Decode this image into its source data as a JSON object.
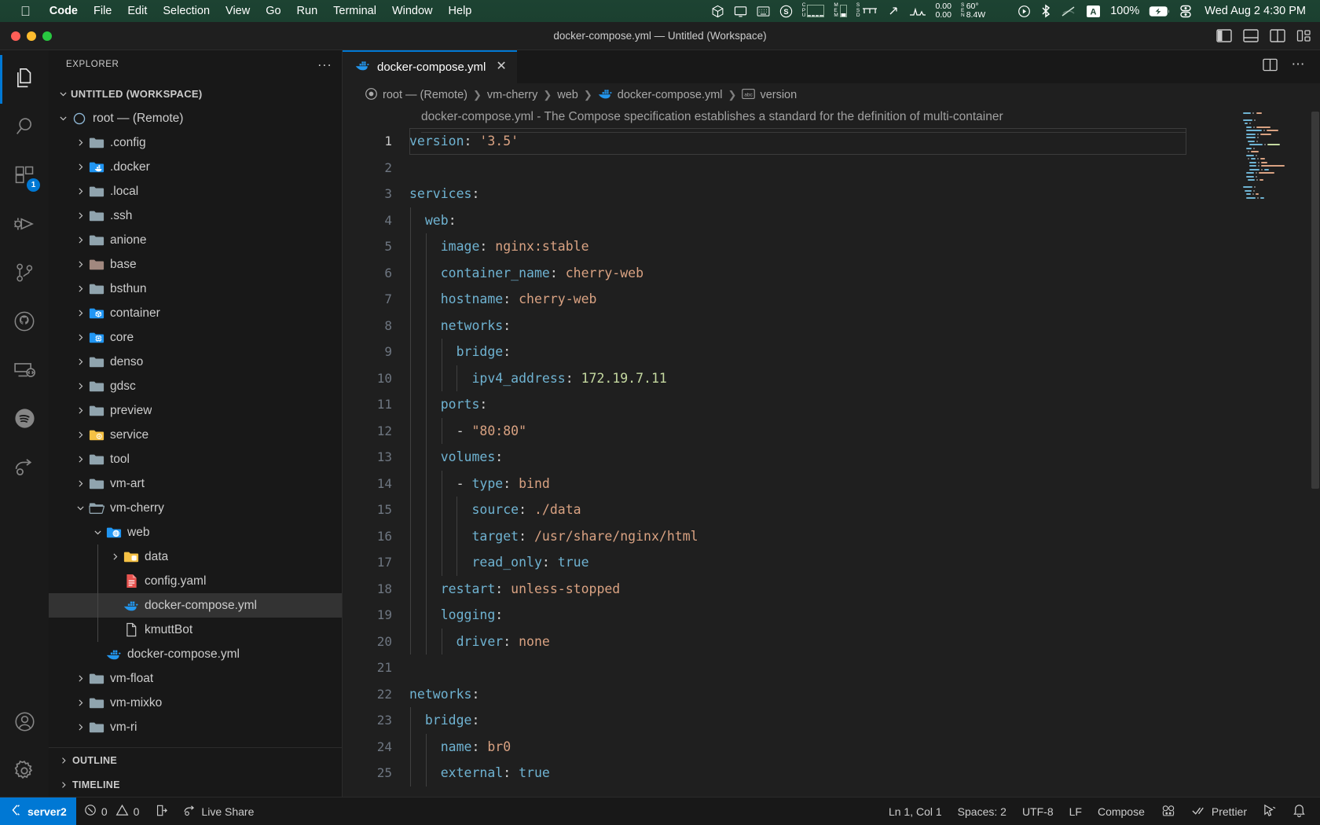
{
  "macos_menu": {
    "apple_icon": "apple-logo-icon",
    "items": [
      {
        "label": "Code",
        "bold": true
      },
      {
        "label": "File",
        "bold": false
      },
      {
        "label": "Edit",
        "bold": false
      },
      {
        "label": "Selection",
        "bold": false
      },
      {
        "label": "View",
        "bold": false
      },
      {
        "label": "Go",
        "bold": false
      },
      {
        "label": "Run",
        "bold": false
      },
      {
        "label": "Terminal",
        "bold": false
      },
      {
        "label": "Window",
        "bold": false
      },
      {
        "label": "Help",
        "bold": false
      }
    ],
    "tray": {
      "cpu_label_top": "C",
      "cpu_label_mid": "P",
      "cpu_label_bot": "U",
      "mem_label": "MEM",
      "ssd_label": "SSD",
      "net_down": "0.00",
      "net_up": "0.00",
      "sen_label": "SEN",
      "temp": "60°",
      "power": "8.4W",
      "battery_pct": "100%",
      "clock": "Wed Aug 2  4:30 PM",
      "input_source": "A",
      "icons": [
        "stats-s-icon",
        "cpu-graph-icon",
        "mem-bar-icon",
        "ssd-bar-icon",
        "network-speed-icon",
        "temperature-icon",
        "airpods-icon",
        "now-playing-icon",
        "bluetooth-icon",
        "wifi-off-icon",
        "input-source-icon",
        "battery-charging-icon",
        "control-center-icon"
      ]
    }
  },
  "window": {
    "title": "docker-compose.yml — Untitled (Workspace)",
    "traffic_lights": [
      "close-button",
      "minimize-button",
      "maximize-button"
    ],
    "layout_buttons": [
      "toggle-primary-sidebar-icon",
      "toggle-panel-icon",
      "toggle-secondary-sidebar-icon",
      "customize-layout-icon"
    ]
  },
  "activity_bar": {
    "items": [
      {
        "name": "explorer",
        "icon": "files-icon",
        "active": true,
        "badge": null
      },
      {
        "name": "search",
        "icon": "search-icon",
        "active": false,
        "badge": null
      },
      {
        "name": "extensions",
        "icon": "extensions-icon",
        "active": false,
        "badge": "1"
      },
      {
        "name": "run-and-debug",
        "icon": "run-debug-icon",
        "active": false,
        "badge": null
      },
      {
        "name": "source-control",
        "icon": "source-control-icon",
        "active": false,
        "badge": null
      },
      {
        "name": "github",
        "icon": "github-icon",
        "active": false,
        "badge": null
      },
      {
        "name": "remote-explorer",
        "icon": "remote-explorer-icon",
        "active": false,
        "badge": null
      },
      {
        "name": "spotify",
        "icon": "spotify-icon",
        "active": false,
        "badge": null
      },
      {
        "name": "live-share",
        "icon": "live-share-icon",
        "active": false,
        "badge": null
      }
    ],
    "bottom_items": [
      {
        "name": "accounts",
        "icon": "account-icon"
      },
      {
        "name": "manage-settings",
        "icon": "gear-icon"
      }
    ]
  },
  "sidebar": {
    "title": "EXPLORER",
    "more_actions": "...",
    "workspace_label": "UNTITLED (WORKSPACE)",
    "tree": [
      {
        "label": "root — (Remote)",
        "depth": 1,
        "twisty": "down",
        "icon": "remote-circle-icon",
        "selected": false
      },
      {
        "label": ".config",
        "depth": 2,
        "twisty": "right",
        "icon": "folder-icon",
        "selected": false
      },
      {
        "label": ".docker",
        "depth": 2,
        "twisty": "right",
        "icon": "folder-docker-icon",
        "selected": false
      },
      {
        "label": ".local",
        "depth": 2,
        "twisty": "right",
        "icon": "folder-icon",
        "selected": false
      },
      {
        "label": ".ssh",
        "depth": 2,
        "twisty": "right",
        "icon": "folder-icon",
        "selected": false
      },
      {
        "label": "anione",
        "depth": 2,
        "twisty": "right",
        "icon": "folder-icon",
        "selected": false
      },
      {
        "label": "base",
        "depth": 2,
        "twisty": "right",
        "icon": "folder-base-icon",
        "selected": false
      },
      {
        "label": "bsthun",
        "depth": 2,
        "twisty": "right",
        "icon": "folder-icon",
        "selected": false
      },
      {
        "label": "container",
        "depth": 2,
        "twisty": "right",
        "icon": "folder-container-icon",
        "selected": false
      },
      {
        "label": "core",
        "depth": 2,
        "twisty": "right",
        "icon": "folder-core-icon",
        "selected": false
      },
      {
        "label": "denso",
        "depth": 2,
        "twisty": "right",
        "icon": "folder-icon",
        "selected": false
      },
      {
        "label": "gdsc",
        "depth": 2,
        "twisty": "right",
        "icon": "folder-icon",
        "selected": false
      },
      {
        "label": "preview",
        "depth": 2,
        "twisty": "right",
        "icon": "folder-icon",
        "selected": false
      },
      {
        "label": "service",
        "depth": 2,
        "twisty": "right",
        "icon": "folder-service-icon",
        "selected": false
      },
      {
        "label": "tool",
        "depth": 2,
        "twisty": "right",
        "icon": "folder-icon",
        "selected": false
      },
      {
        "label": "vm-art",
        "depth": 2,
        "twisty": "right",
        "icon": "folder-icon",
        "selected": false
      },
      {
        "label": "vm-cherry",
        "depth": 2,
        "twisty": "down",
        "icon": "folder-open-icon",
        "selected": false
      },
      {
        "label": "web",
        "depth": 3,
        "twisty": "down",
        "icon": "folder-web-icon",
        "selected": false
      },
      {
        "label": "data",
        "depth": 4,
        "twisty": "right",
        "icon": "folder-data-icon",
        "selected": false
      },
      {
        "label": "config.yaml",
        "depth": 4,
        "twisty": "none",
        "icon": "yaml-file-icon",
        "selected": false
      },
      {
        "label": "docker-compose.yml",
        "depth": 4,
        "twisty": "none",
        "icon": "docker-file-icon",
        "selected": true
      },
      {
        "label": "kmuttBot",
        "depth": 4,
        "twisty": "none",
        "icon": "plain-file-icon",
        "selected": false
      },
      {
        "label": "docker-compose.yml",
        "depth": 3,
        "twisty": "none",
        "icon": "docker-file-icon",
        "selected": false
      },
      {
        "label": "vm-float",
        "depth": 2,
        "twisty": "right",
        "icon": "folder-icon",
        "selected": false
      },
      {
        "label": "vm-mixko",
        "depth": 2,
        "twisty": "right",
        "icon": "folder-icon",
        "selected": false
      },
      {
        "label": "vm-ri",
        "depth": 2,
        "twisty": "right",
        "icon": "folder-icon",
        "selected": false
      }
    ],
    "sections": [
      {
        "label": "OUTLINE"
      },
      {
        "label": "TIMELINE"
      }
    ]
  },
  "editor": {
    "tab": {
      "label": "docker-compose.yml",
      "icon": "docker-file-icon",
      "close": "✕"
    },
    "actions": [
      "split-editor-icon",
      "more-actions-icon"
    ],
    "breadcrumbs": [
      {
        "label": "root — (Remote)",
        "icon": "remote-circle-icon"
      },
      {
        "label": "vm-cherry",
        "icon": null
      },
      {
        "label": "web",
        "icon": null
      },
      {
        "label": "docker-compose.yml",
        "icon": "docker-file-icon"
      },
      {
        "label": "version",
        "icon": "symbol-string-icon"
      }
    ],
    "hover_text": "docker-compose.yml - The Compose specification establishes a standard for the definition of multi-container",
    "lines": [
      {
        "n": 1,
        "current": true,
        "indent_guides": 0,
        "tokens": [
          {
            "t": "version",
            "c": "k"
          },
          {
            "t": ":",
            "c": "p"
          },
          {
            "t": " ",
            "c": "p"
          },
          {
            "t": "'3.5'",
            "c": "s"
          }
        ]
      },
      {
        "n": 2,
        "current": false,
        "indent_guides": 0,
        "tokens": []
      },
      {
        "n": 3,
        "current": false,
        "indent_guides": 0,
        "tokens": [
          {
            "t": "services",
            "c": "k"
          },
          {
            "t": ":",
            "c": "p"
          }
        ]
      },
      {
        "n": 4,
        "current": false,
        "indent_guides": 1,
        "tokens": [
          {
            "t": "  ",
            "c": "p"
          },
          {
            "t": "web",
            "c": "k"
          },
          {
            "t": ":",
            "c": "p"
          }
        ]
      },
      {
        "n": 5,
        "current": false,
        "indent_guides": 2,
        "tokens": [
          {
            "t": "    ",
            "c": "p"
          },
          {
            "t": "image",
            "c": "k"
          },
          {
            "t": ": ",
            "c": "p"
          },
          {
            "t": "nginx:stable",
            "c": "s"
          }
        ]
      },
      {
        "n": 6,
        "current": false,
        "indent_guides": 2,
        "tokens": [
          {
            "t": "    ",
            "c": "p"
          },
          {
            "t": "container_name",
            "c": "k"
          },
          {
            "t": ": ",
            "c": "p"
          },
          {
            "t": "cherry-web",
            "c": "s"
          }
        ]
      },
      {
        "n": 7,
        "current": false,
        "indent_guides": 2,
        "tokens": [
          {
            "t": "    ",
            "c": "p"
          },
          {
            "t": "hostname",
            "c": "k"
          },
          {
            "t": ": ",
            "c": "p"
          },
          {
            "t": "cherry-web",
            "c": "s"
          }
        ]
      },
      {
        "n": 8,
        "current": false,
        "indent_guides": 2,
        "tokens": [
          {
            "t": "    ",
            "c": "p"
          },
          {
            "t": "networks",
            "c": "k"
          },
          {
            "t": ":",
            "c": "p"
          }
        ]
      },
      {
        "n": 9,
        "current": false,
        "indent_guides": 3,
        "tokens": [
          {
            "t": "      ",
            "c": "p"
          },
          {
            "t": "bridge",
            "c": "k"
          },
          {
            "t": ":",
            "c": "p"
          }
        ]
      },
      {
        "n": 10,
        "current": false,
        "indent_guides": 4,
        "tokens": [
          {
            "t": "        ",
            "c": "p"
          },
          {
            "t": "ipv4_address",
            "c": "k"
          },
          {
            "t": ": ",
            "c": "p"
          },
          {
            "t": "172.19.7.11",
            "c": "num"
          }
        ]
      },
      {
        "n": 11,
        "current": false,
        "indent_guides": 2,
        "tokens": [
          {
            "t": "    ",
            "c": "p"
          },
          {
            "t": "ports",
            "c": "k"
          },
          {
            "t": ":",
            "c": "p"
          }
        ]
      },
      {
        "n": 12,
        "current": false,
        "indent_guides": 3,
        "tokens": [
          {
            "t": "      ",
            "c": "p"
          },
          {
            "t": "- ",
            "c": "dash"
          },
          {
            "t": "\"80:80\"",
            "c": "s"
          }
        ]
      },
      {
        "n": 13,
        "current": false,
        "indent_guides": 2,
        "tokens": [
          {
            "t": "    ",
            "c": "p"
          },
          {
            "t": "volumes",
            "c": "k"
          },
          {
            "t": ":",
            "c": "p"
          }
        ]
      },
      {
        "n": 14,
        "current": false,
        "indent_guides": 3,
        "tokens": [
          {
            "t": "      ",
            "c": "p"
          },
          {
            "t": "- ",
            "c": "dash"
          },
          {
            "t": "type",
            "c": "k"
          },
          {
            "t": ": ",
            "c": "p"
          },
          {
            "t": "bind",
            "c": "s"
          }
        ]
      },
      {
        "n": 15,
        "current": false,
        "indent_guides": 4,
        "tokens": [
          {
            "t": "        ",
            "c": "p"
          },
          {
            "t": "source",
            "c": "k"
          },
          {
            "t": ": ",
            "c": "p"
          },
          {
            "t": "./data",
            "c": "s"
          }
        ]
      },
      {
        "n": 16,
        "current": false,
        "indent_guides": 4,
        "tokens": [
          {
            "t": "        ",
            "c": "p"
          },
          {
            "t": "target",
            "c": "k"
          },
          {
            "t": ": ",
            "c": "p"
          },
          {
            "t": "/usr/share/nginx/html",
            "c": "s"
          }
        ]
      },
      {
        "n": 17,
        "current": false,
        "indent_guides": 4,
        "tokens": [
          {
            "t": "        ",
            "c": "p"
          },
          {
            "t": "read_only",
            "c": "k"
          },
          {
            "t": ": ",
            "c": "p"
          },
          {
            "t": "true",
            "c": "b"
          }
        ]
      },
      {
        "n": 18,
        "current": false,
        "indent_guides": 2,
        "tokens": [
          {
            "t": "    ",
            "c": "p"
          },
          {
            "t": "restart",
            "c": "k"
          },
          {
            "t": ": ",
            "c": "p"
          },
          {
            "t": "unless-stopped",
            "c": "s"
          }
        ]
      },
      {
        "n": 19,
        "current": false,
        "indent_guides": 2,
        "tokens": [
          {
            "t": "    ",
            "c": "p"
          },
          {
            "t": "logging",
            "c": "k"
          },
          {
            "t": ":",
            "c": "p"
          }
        ]
      },
      {
        "n": 20,
        "current": false,
        "indent_guides": 3,
        "tokens": [
          {
            "t": "      ",
            "c": "p"
          },
          {
            "t": "driver",
            "c": "k"
          },
          {
            "t": ": ",
            "c": "p"
          },
          {
            "t": "none",
            "c": "s"
          }
        ]
      },
      {
        "n": 21,
        "current": false,
        "indent_guides": 0,
        "tokens": []
      },
      {
        "n": 22,
        "current": false,
        "indent_guides": 0,
        "tokens": [
          {
            "t": "networks",
            "c": "k"
          },
          {
            "t": ":",
            "c": "p"
          }
        ]
      },
      {
        "n": 23,
        "current": false,
        "indent_guides": 1,
        "tokens": [
          {
            "t": "  ",
            "c": "p"
          },
          {
            "t": "bridge",
            "c": "k"
          },
          {
            "t": ":",
            "c": "p"
          }
        ]
      },
      {
        "n": 24,
        "current": false,
        "indent_guides": 2,
        "tokens": [
          {
            "t": "    ",
            "c": "p"
          },
          {
            "t": "name",
            "c": "k"
          },
          {
            "t": ": ",
            "c": "p"
          },
          {
            "t": "br0",
            "c": "s"
          }
        ]
      },
      {
        "n": 25,
        "current": false,
        "indent_guides": 2,
        "tokens": [
          {
            "t": "    ",
            "c": "p"
          },
          {
            "t": "external",
            "c": "k"
          },
          {
            "t": ": ",
            "c": "p"
          },
          {
            "t": "true",
            "c": "b"
          }
        ]
      }
    ]
  },
  "status_bar": {
    "remote": {
      "label": "server2",
      "icon": "remote-indicator-icon"
    },
    "problems": {
      "errors": "0",
      "warnings": "0",
      "error_icon": "error-circle-icon",
      "warning_icon": "warning-triangle-icon"
    },
    "ports": {
      "icon": "ports-icon"
    },
    "live_share": {
      "label": "Live Share",
      "icon": "live-share-icon"
    },
    "right": [
      {
        "name": "editor-position",
        "label": "Ln 1, Col 1"
      },
      {
        "name": "indentation",
        "label": "Spaces: 2"
      },
      {
        "name": "encoding",
        "label": "UTF-8"
      },
      {
        "name": "eol",
        "label": "LF"
      },
      {
        "name": "language-mode",
        "label": "Compose"
      },
      {
        "name": "docker-status",
        "label": "",
        "icon": "docker-whale-icon"
      },
      {
        "name": "prettier",
        "label": "Prettier",
        "icon": "checkmarks-icon"
      },
      {
        "name": "screencast-mode",
        "label": "",
        "icon": "screencast-icon"
      },
      {
        "name": "notifications",
        "label": "",
        "icon": "bell-icon"
      }
    ]
  },
  "colors": {
    "accent": "#0078d4",
    "editor_bg": "#1f1f1f",
    "sidebar_bg": "#181818",
    "activitybar_bg": "#1a1a1a",
    "menubar_bg": "#1d4332",
    "key_blue": "#6fb3d2",
    "string_orange": "#d9a282",
    "number_green": "#c5d9a0",
    "linenumber": "#6e7681"
  }
}
